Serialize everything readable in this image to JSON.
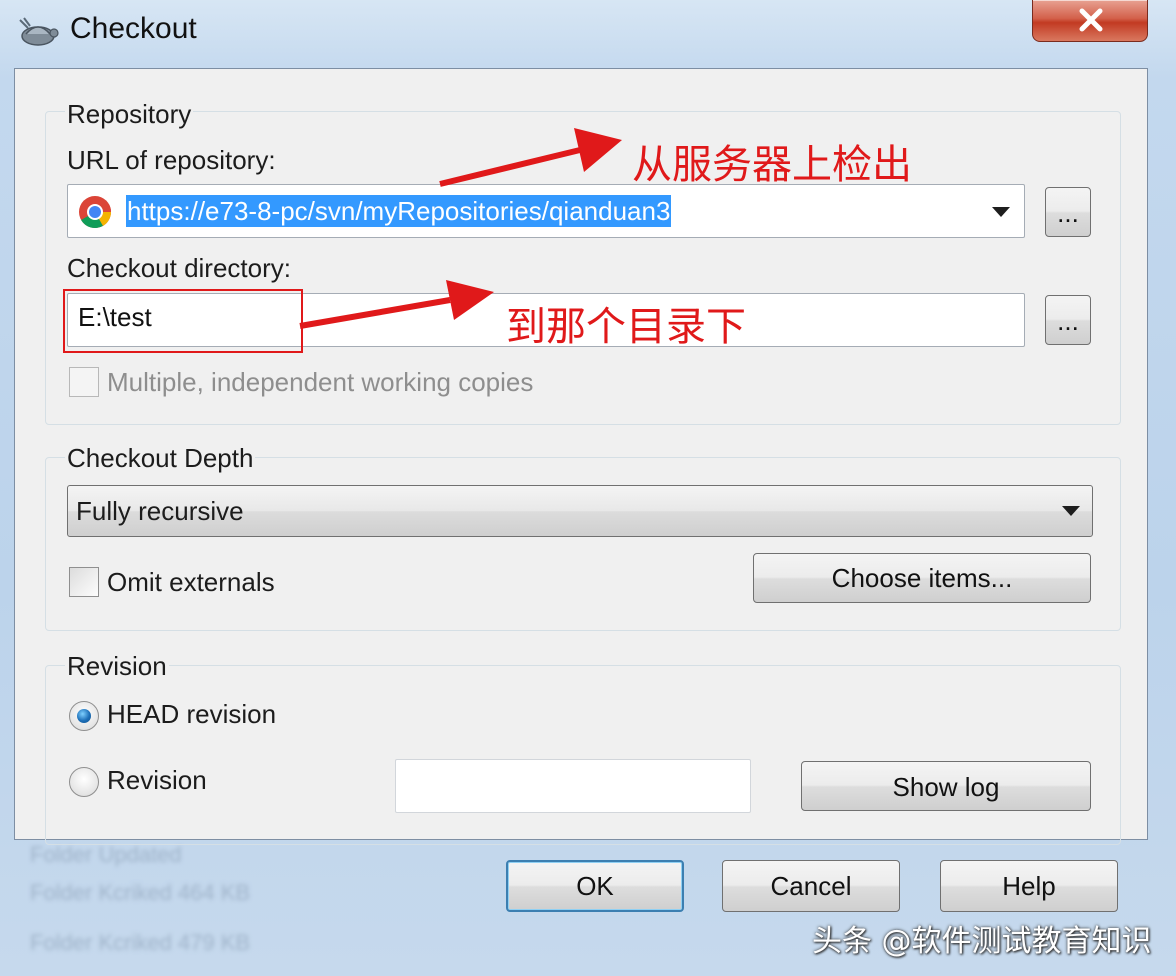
{
  "window": {
    "title": "Checkout",
    "close_label": "X"
  },
  "repository": {
    "group_label": "Repository",
    "url_label": "URL of repository:",
    "url_value": "https://e73-8-pc/svn/myRepositories/qianduan3",
    "browse_url_label": "...",
    "dir_label": "Checkout directory:",
    "dir_value": "E:\\test",
    "browse_dir_label": "...",
    "multiple_label": "Multiple, independent working copies",
    "multiple_checked": false
  },
  "depth": {
    "group_label": "Checkout Depth",
    "selected": "Fully recursive",
    "omit_externals_label": "Omit externals",
    "omit_externals_checked": false,
    "choose_items_label": "Choose items..."
  },
  "revision": {
    "group_label": "Revision",
    "head_label": "HEAD revision",
    "revision_label": "Revision",
    "selected": "HEAD revision",
    "revision_value": "",
    "show_log_label": "Show log"
  },
  "footer": {
    "ok_label": "OK",
    "cancel_label": "Cancel",
    "help_label": "Help"
  },
  "annotations": {
    "url_note": "从服务器上检出",
    "dir_note": "到那个目录下",
    "color": "#e0191a"
  },
  "watermark": "头条 @软件测试教育知识"
}
